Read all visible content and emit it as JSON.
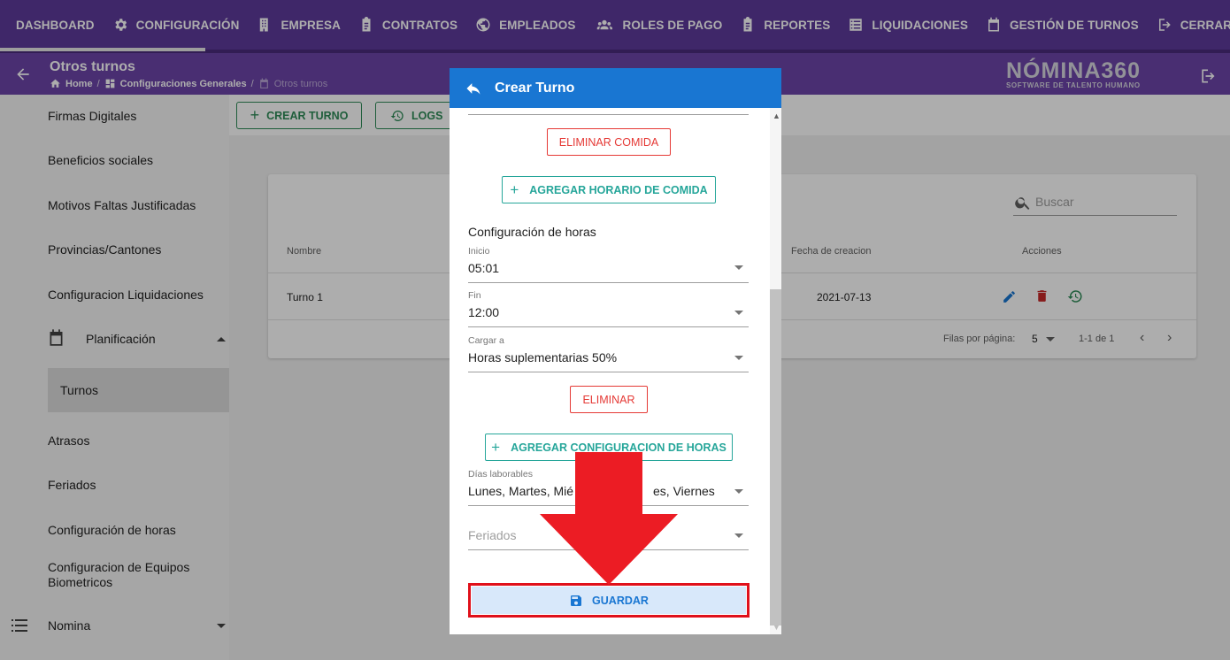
{
  "topnav": {
    "items": [
      {
        "label": "DASHBOARD",
        "icon": "none"
      },
      {
        "label": "CONFIGURACIÓN",
        "icon": "gear-icon"
      },
      {
        "label": "EMPRESA",
        "icon": "building-icon"
      },
      {
        "label": "CONTRATOS",
        "icon": "clipboard-icon"
      },
      {
        "label": "EMPLEADOS",
        "icon": "globe-icon"
      },
      {
        "label": "ROLES DE PAGO",
        "icon": "people-icon"
      },
      {
        "label": "REPORTES",
        "icon": "clipboard-icon"
      },
      {
        "label": "LIQUIDACIONES",
        "icon": "list-icon"
      },
      {
        "label": "GESTIÓN DE TURNOS",
        "icon": "calendar-icon"
      },
      {
        "label": "CERRAR SESIÓN",
        "icon": "logout-icon"
      }
    ]
  },
  "subbar": {
    "title": "Otros turnos",
    "breadcrumb": [
      "Home",
      "Configuraciones Generales",
      "Otros turnos"
    ],
    "logo_main": "NÓMINA360",
    "logo_sub": "SOFTWARE DE TALENTO HUMANO"
  },
  "sidebar": {
    "items": [
      "Firmas Digitales",
      "Beneficios sociales",
      "Motivos Faltas Justificadas",
      "Provincias/Cantones",
      "Configuracion Liquidaciones",
      "Planificación",
      "Turnos",
      "Atrasos",
      "Feriados",
      "Configuración de horas",
      "Configuracion de Equipos Biometricos",
      "Nomina"
    ]
  },
  "toolbar": {
    "create_label": "CREAR TURNO",
    "logs_label": "LOGS"
  },
  "table": {
    "search_placeholder": "Buscar",
    "headers": [
      "Nombre",
      "Fecha de creacion",
      "Acciones"
    ],
    "rows": [
      {
        "nombre": "Turno 1",
        "fecha": "2021-07-13"
      }
    ],
    "footer": {
      "rows_per_page_label": "Filas por página:",
      "rows_per_page": "5",
      "range": "1-1 de 1"
    }
  },
  "modal": {
    "title": "Crear Turno",
    "eliminar_comida": "ELIMINAR COMIDA",
    "agregar_comida": "AGREGAR HORARIO DE COMIDA",
    "section_title": "Configuración de horas",
    "inicio_label": "Inicio",
    "inicio_value": "05:01",
    "fin_label": "Fin",
    "fin_value": "12:00",
    "cargar_label": "Cargar a",
    "cargar_value": "Horas suplementarias 50%",
    "eliminar": "ELIMINAR",
    "agregar_config": "AGREGAR CONFIGURACION DE HORAS",
    "dias_label": "Días laborables",
    "dias_value": "Lunes, Martes, Mié",
    "dias_value_tail": "es, Viernes",
    "feriados_placeholder": "Feriados",
    "save_label": "GUARDAR"
  },
  "colors": {
    "nav_purple": "#5e3a9b",
    "modal_blue": "#1976d2",
    "highlight_red": "#e0101a",
    "danger_red": "#e53935",
    "teal": "#26a69a"
  }
}
